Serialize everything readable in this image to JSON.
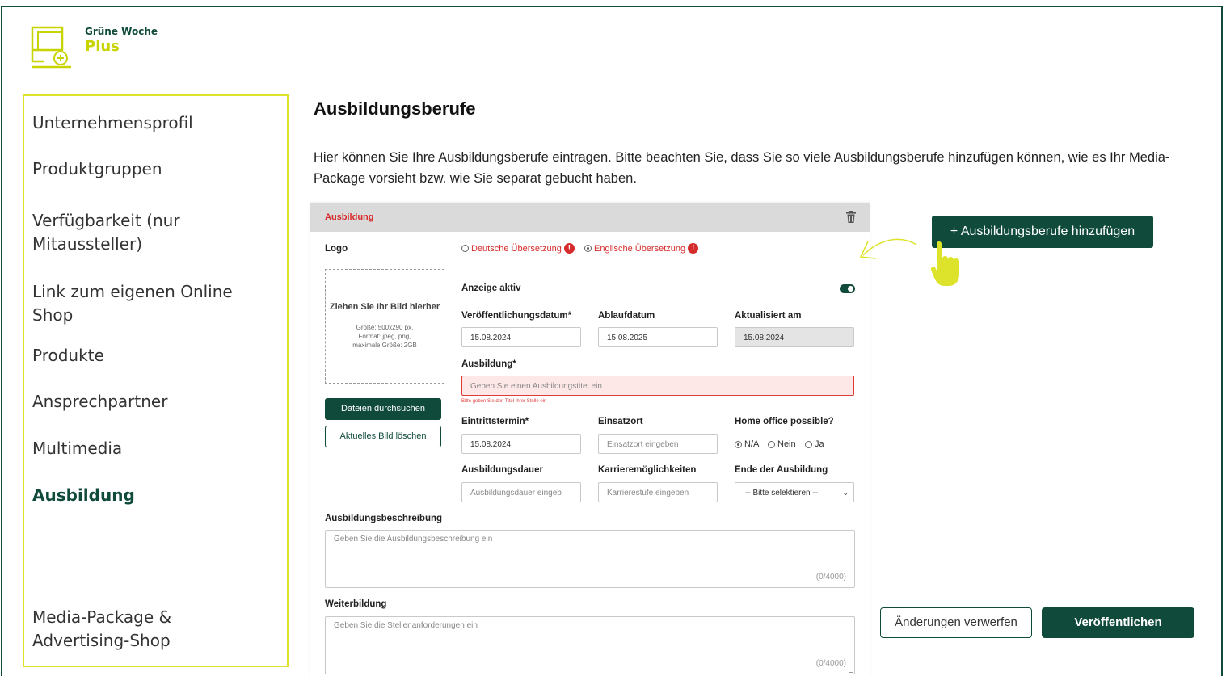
{
  "brand": {
    "name_top": "Grüne Woche",
    "name_bottom": "Plus",
    "icon": "monitor-plus-icon",
    "color_primary": "#0f4a3a",
    "color_accent": "#c8d400"
  },
  "sidebar": {
    "items": [
      {
        "label": "Unternehmensprofil"
      },
      {
        "label": "Produktgruppen"
      },
      {
        "label": "Verfügbarkeit (nur Mitaussteller)"
      },
      {
        "label": "Link zum eigenen Online Shop"
      },
      {
        "label": "Produkte"
      },
      {
        "label": "Ansprechpartner"
      },
      {
        "label": "Multimedia"
      },
      {
        "label": "Ausbildung"
      },
      {
        "label": "Media-Package & Advertising-Shop"
      }
    ],
    "active": "Ausbildung"
  },
  "page": {
    "title": "Ausbildungsberufe",
    "intro": "Hier können Sie Ihre Ausbildungsberufe eintragen. Bitte beachten Sie, dass Sie so viele Ausbildungsberufe hinzufügen können, wie es Ihr Media-Package vorsieht bzw. wie Sie separat gebucht haben."
  },
  "card": {
    "header": "Ausbildung",
    "logo_label": "Logo",
    "translations": {
      "german": "Deutsche Übersetzung",
      "english": "Englische Übersetzung",
      "selected": "english",
      "warning_icon": "exclamation-icon"
    },
    "dropzone": {
      "title": "Ziehen Sie Ihr Bild hierher",
      "info": "Größe: 500x290 px,\nFormat: jpeg, png,\nmaximale Größe: 2GB"
    },
    "browse_button": "Dateien durchsuchen",
    "delete_image_button": "Aktuelles Bild löschen",
    "active_label": "Anzeige aktiv",
    "active_on": true,
    "publish_date": {
      "label": "Veröffentlichungsdatum*",
      "value": "15.08.2024"
    },
    "expiry_date": {
      "label": "Ablaufdatum",
      "value": "15.08.2025"
    },
    "updated": {
      "label": "Aktualisiert am",
      "value": "15.08.2024"
    },
    "training": {
      "label": "Ausbildung*",
      "placeholder": "Geben Sie einen Ausbildungstitel ein",
      "error": "Bitte geben Sie den Titel Ihrer Stelle ein"
    },
    "start_date": {
      "label": "Eintrittstermin*",
      "value": "15.08.2024"
    },
    "location": {
      "label": "Einsatzort",
      "placeholder": "Einsatzort eingeben"
    },
    "home_office": {
      "label": "Home office possible?",
      "options": [
        "N/A",
        "Nein",
        "Ja"
      ],
      "selected": "N/A"
    },
    "duration": {
      "label": "Ausbildungsdauer",
      "placeholder": "Ausbildungsdauer eingeb"
    },
    "career": {
      "label": "Karrieremöglichkeiten",
      "placeholder": "Karrierestufe eingeben"
    },
    "end": {
      "label": "Ende der Ausbildung",
      "selected": "-- Bitte selektieren --"
    },
    "description": {
      "label": "Ausbildungsbeschreibung",
      "placeholder": "Geben Sie die Ausbildungsbeschreibung ein",
      "counter": "(0/4000)"
    },
    "further": {
      "label": "Weiterbildung",
      "placeholder": "Geben Sie die Stellenanforderungen ein",
      "counter": "(0/4000)"
    }
  },
  "actions": {
    "add": "+ Ausbildungsberufe hinzufügen",
    "discard": "Änderungen verwerfen",
    "publish": "Veröffentlichen",
    "hint_icon": "pointing-hand-icon"
  }
}
